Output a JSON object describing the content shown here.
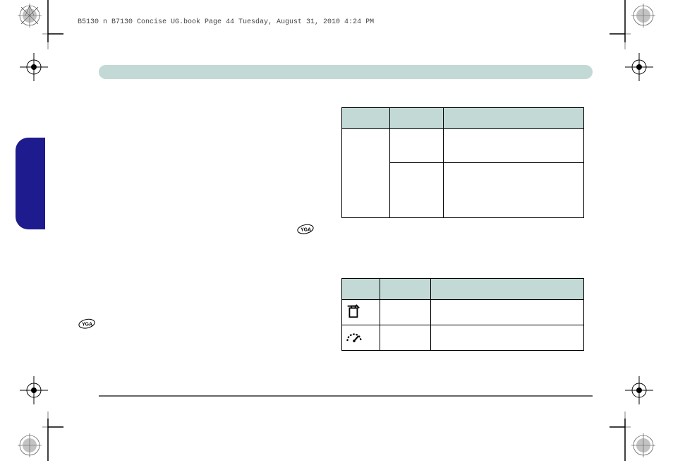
{
  "header": {
    "text": "B5130 n B7130 Concise UG.book  Page 44  Tuesday, August 31, 2010  4:24 PM"
  },
  "table1": {
    "headers": [
      "",
      "",
      ""
    ],
    "cells": {
      "r1c2": "",
      "r1c3": "",
      "r2c2": "",
      "r2c3": ""
    }
  },
  "table2": {
    "headers": [
      "",
      "",
      ""
    ],
    "cells": {
      "r1c2": "",
      "r1c3": "",
      "r2c2": "",
      "r2c3": ""
    }
  },
  "icons": {
    "vga": "YGA",
    "battery": "battery-icon",
    "gauge": "gauge-icon"
  }
}
